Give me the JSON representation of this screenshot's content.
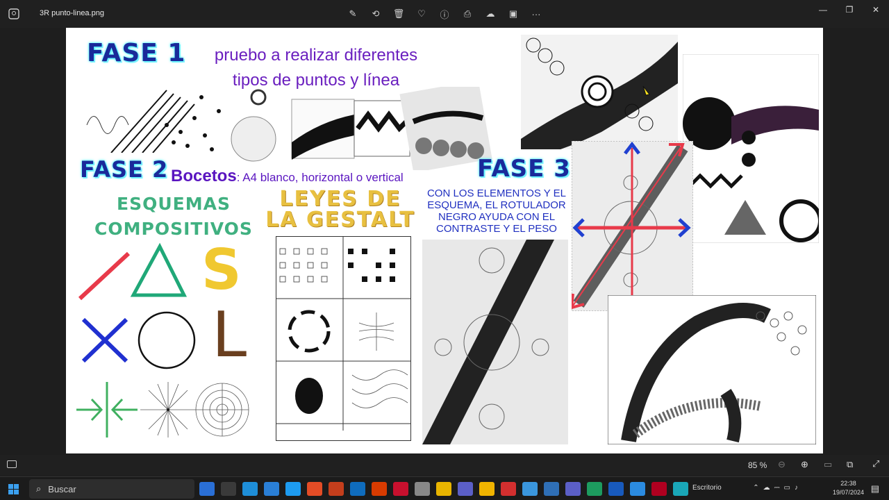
{
  "window": {
    "title": "3R punto-linea.png"
  },
  "toolbar": {
    "items": [
      {
        "name": "edit-icon",
        "glyph": "✎"
      },
      {
        "name": "rotate-icon",
        "glyph": "⟲"
      },
      {
        "name": "delete-icon",
        "glyph": "🗑"
      },
      {
        "name": "favorite-icon",
        "glyph": "♡"
      },
      {
        "name": "info-icon",
        "glyph": "ⓘ"
      },
      {
        "name": "print-icon",
        "glyph": "⎙"
      },
      {
        "name": "onedrive-icon",
        "glyph": "☁"
      },
      {
        "name": "clipchamp-icon",
        "glyph": "▣"
      },
      {
        "name": "more-icon",
        "glyph": "···"
      }
    ]
  },
  "window_controls": {
    "minimize": "—",
    "maximize": "❐",
    "close": "✕"
  },
  "slide": {
    "fase1": "FASE 1",
    "fase1_text_line1": "pruebo a realizar diferentes",
    "fase1_text_line2": "tipos de puntos y línea",
    "fase2": "FASE 2",
    "bocetos_label": "Bocetos",
    "bocetos_text": ": A4 blanco, horizontal o vertical",
    "fase3": "FASE 3",
    "fase3_text": [
      "CON LOS ELEMENTOS Y EL",
      "ESQUEMA, EL ROTULADOR",
      "NEGRO AYUDA CON EL",
      "CONTRASTE Y EL PESO"
    ],
    "esquemas": [
      "ESQUEMAS",
      "COMPOSITIVOS"
    ],
    "gestalt": [
      "LEYES DE",
      "LA GESTALT"
    ],
    "shape_s": "S",
    "shape_l": "L"
  },
  "statusbar": {
    "zoom": "85 %"
  },
  "taskbar": {
    "search_placeholder": "Buscar",
    "desktop_label": "Escritorio",
    "time": "22:38",
    "date": "19/07/2024"
  },
  "colors": {
    "fase_text": "#1a2a9a",
    "fase_glow": "#5ff",
    "purple": "#6a1fbf",
    "gestalt": "#e8c040",
    "esquemas": "#40b080",
    "red": "#e83a4a",
    "green": "#20b080",
    "yellow": "#f0c830",
    "blue": "#2030d0",
    "brown": "#6a3f1f"
  }
}
